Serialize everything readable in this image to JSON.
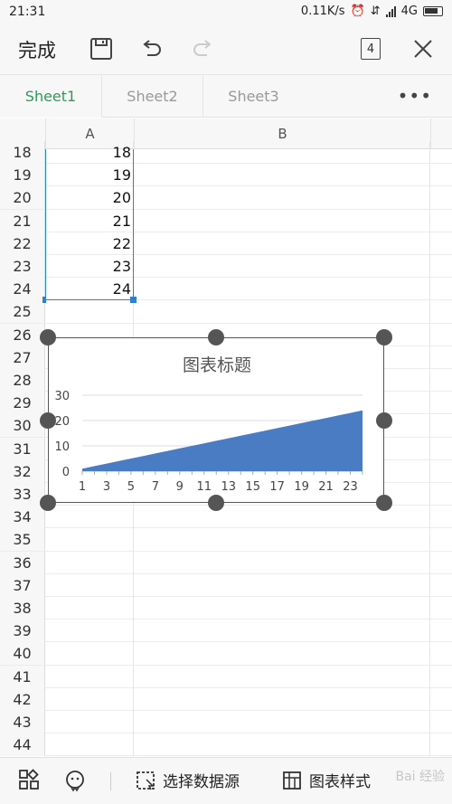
{
  "status_bar": {
    "time": "21:31",
    "speed": "0.11K/s",
    "network": "4G"
  },
  "toolbar": {
    "done_label": "完成",
    "sheet_count": "4"
  },
  "tabs": [
    {
      "label": "Sheet1",
      "active": true
    },
    {
      "label": "Sheet2",
      "active": false
    },
    {
      "label": "Sheet3",
      "active": false
    }
  ],
  "more_label": "•••",
  "columns": [
    "A",
    "B"
  ],
  "rows": [
    {
      "n": "18",
      "a": "18"
    },
    {
      "n": "19",
      "a": "19"
    },
    {
      "n": "20",
      "a": "20"
    },
    {
      "n": "21",
      "a": "21"
    },
    {
      "n": "22",
      "a": "22"
    },
    {
      "n": "23",
      "a": "23"
    },
    {
      "n": "24",
      "a": "24"
    },
    {
      "n": "25",
      "a": ""
    },
    {
      "n": "26",
      "a": ""
    },
    {
      "n": "27",
      "a": ""
    },
    {
      "n": "28",
      "a": ""
    },
    {
      "n": "29",
      "a": ""
    },
    {
      "n": "30",
      "a": ""
    },
    {
      "n": "31",
      "a": ""
    },
    {
      "n": "32",
      "a": ""
    },
    {
      "n": "33",
      "a": ""
    },
    {
      "n": "34",
      "a": ""
    },
    {
      "n": "35",
      "a": ""
    },
    {
      "n": "36",
      "a": ""
    },
    {
      "n": "37",
      "a": ""
    },
    {
      "n": "38",
      "a": ""
    },
    {
      "n": "39",
      "a": ""
    },
    {
      "n": "40",
      "a": ""
    },
    {
      "n": "41",
      "a": ""
    },
    {
      "n": "42",
      "a": ""
    },
    {
      "n": "43",
      "a": ""
    },
    {
      "n": "44",
      "a": ""
    }
  ],
  "chart_data": {
    "type": "area",
    "title": "图表标题",
    "x": [
      1,
      2,
      3,
      4,
      5,
      6,
      7,
      8,
      9,
      10,
      11,
      12,
      13,
      14,
      15,
      16,
      17,
      18,
      19,
      20,
      21,
      22,
      23,
      24
    ],
    "x_tick_labels": [
      "1",
      "3",
      "5",
      "7",
      "9",
      "11",
      "13",
      "15",
      "17",
      "19",
      "21",
      "23"
    ],
    "series": [
      {
        "values": [
          1,
          2,
          3,
          4,
          5,
          6,
          7,
          8,
          9,
          10,
          11,
          12,
          13,
          14,
          15,
          16,
          17,
          18,
          19,
          20,
          21,
          22,
          23,
          24
        ]
      }
    ],
    "y_ticks": [
      "0",
      "10",
      "20",
      "30"
    ],
    "ylim": [
      0,
      30
    ],
    "grid": true,
    "color": "#4a7cc4"
  },
  "bottom_bar": {
    "select_source_label": "选择数据源",
    "chart_style_label": "图表样式"
  },
  "watermark": "Bai 经验"
}
